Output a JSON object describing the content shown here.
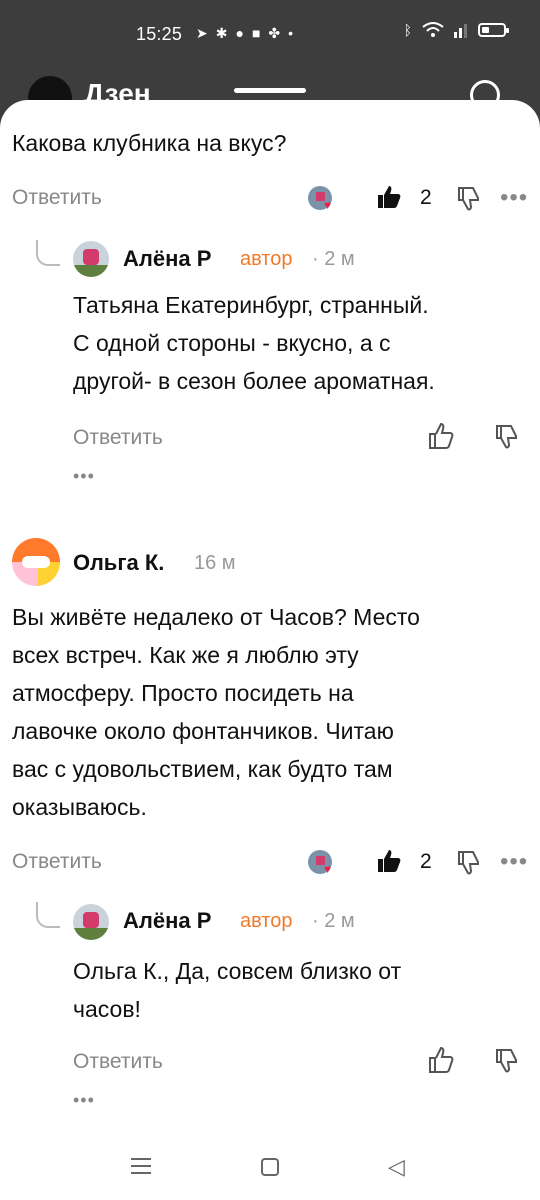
{
  "status_bar": {
    "time": "15:25",
    "left_icons": [
      "telegram-icon",
      "walk-icon",
      "pinterest-icon",
      "mail-icon",
      "app-icon",
      "dot-icon"
    ],
    "right_icons": [
      "bluetooth-icon",
      "wifi-icon",
      "signal-icon",
      "battery-icon"
    ]
  },
  "app_header": {
    "title": "Дзен"
  },
  "comments": [
    {
      "text": "Какова клубника на вкус?",
      "reply_label": "Ответить",
      "likes": "2"
    },
    {
      "author": "Алёна Р",
      "author_tag": "автор",
      "time": "· 2 м",
      "text_lines": [
        "Татьяна Екатеринбург, странный.",
        "С одной стороны - вкусно, а с",
        "другой- в сезон более ароматная."
      ],
      "reply_label": "Ответить",
      "more": "•••"
    },
    {
      "author": "Ольга К.",
      "time": "16 м",
      "text_lines": [
        "Вы живёте недалеко от Часов? Место",
        "всех встреч. Как же я люблю эту",
        "атмосферу. Просто посидеть на",
        "лавочке около фонтанчиков. Читаю",
        "вас с удовольствием, как будто там",
        "оказываюсь."
      ],
      "reply_label": "Ответить",
      "likes": "2"
    },
    {
      "author": "Алёна Р",
      "author_tag": "автор",
      "time": "· 2 м",
      "text_lines": [
        "Ольга К., Да, совсем близко от",
        "часов!"
      ],
      "reply_label": "Ответить",
      "more": "•••"
    }
  ],
  "more_label": "•••",
  "colors": {
    "author_tag": "#f07a2a",
    "heart": "#e8234b",
    "background_dim": "#3d3d3d"
  }
}
